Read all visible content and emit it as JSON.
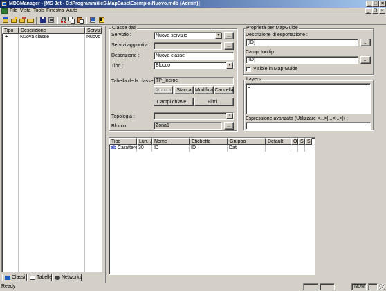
{
  "window": {
    "title": "MDBManager - [MS Jet - C:\\Programmi\\IeS\\MapBase\\Esempio\\Nuovo.mdb (Admin)]"
  },
  "menu": {
    "items": [
      "File",
      "Vista",
      "Tools",
      "Finestra",
      "Aiuto"
    ]
  },
  "left": {
    "columns": [
      "Tipo",
      "Descrizione",
      "Servizio"
    ],
    "rows": [
      {
        "tipo": "+",
        "descrizione": "Nuova classe",
        "servizio": "Nuovo s"
      }
    ],
    "tabs": [
      "Classi",
      "Tabelle",
      "Networks"
    ]
  },
  "classe": {
    "group_title": "Classe dati",
    "servizio_label": "Servizio :",
    "servizio_value": "Nuovo servizio",
    "servizi_agg_label": "Servizi aggiuntivi :",
    "servizi_agg_value": "",
    "descrizione_label": "Descrizione :",
    "descrizione_value": "Nuova classe",
    "tipo_label": "Tipo :",
    "tipo_value": "Blocco",
    "tabella_label": "Tabella della classe :",
    "tabella_value": "TP_Incroci",
    "btn_attacca": "Attacca",
    "btn_stacca": "Stacca",
    "btn_modifica": "Modifica",
    "btn_cancella": "Cancella",
    "btn_campi_chiave": "Campi chiave...",
    "btn_filtri": "Filtri...",
    "topologia_label": "Topologia :",
    "topologia_value": "",
    "blocco_label": "Blocco:",
    "blocco_value": "Zona1",
    "ellipsis": "..."
  },
  "mapguide": {
    "group_title": "Proprietà per MapGuide",
    "descr_label": "Descrizione di esportazione :",
    "descr_value": "[ID]",
    "tooltip_label": "Campi tooltip :",
    "tooltip_value": "[ID]",
    "visible_label": "Visible in Map Guide",
    "visible_checked": false
  },
  "layers": {
    "group_title": "Layers",
    "items": [
      "0"
    ]
  },
  "espressione": {
    "label": "Espressione avanzata (Utilizzare <...>[...<...>]) :",
    "value": ""
  },
  "grid": {
    "columns": [
      "Tipo",
      "Lun...",
      "Nome",
      "Etichetta",
      "Gruppo",
      "Default",
      "O",
      "S",
      "S"
    ],
    "rows": [
      {
        "tipo_icon": "ab",
        "tipo": "Carattere",
        "lun": "30",
        "nome": "ID",
        "etichetta": "ID",
        "gruppo": "Dati",
        "default": "",
        "o": "",
        "s1": "",
        "s2": ""
      }
    ]
  },
  "status": {
    "text": "Ready",
    "num": "NUM"
  },
  "colors": {
    "titlebar": "#0a246a",
    "face": "#d4d0c8"
  }
}
